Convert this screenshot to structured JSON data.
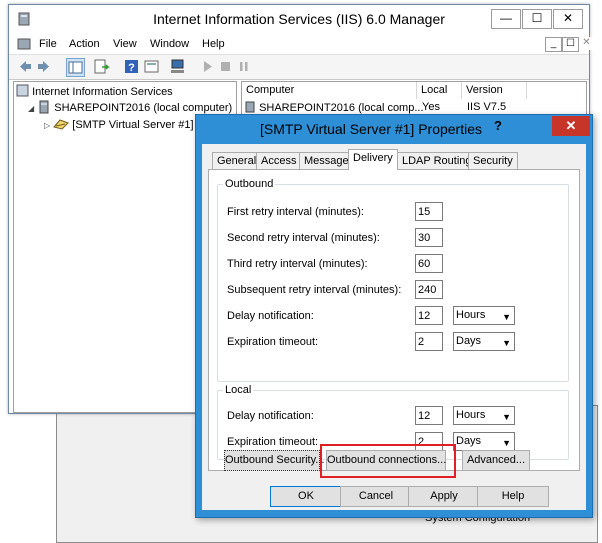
{
  "background_window": {
    "item_label": "System Configuration"
  },
  "iis": {
    "title": "Internet Information Services (IIS) 6.0 Manager",
    "caption": {
      "minimize": "—",
      "maximize": "☐",
      "close": "✕"
    },
    "menu": [
      "File",
      "Action",
      "View",
      "Window",
      "Help"
    ],
    "mdi": {
      "minimize": "_",
      "restore": "☐",
      "close": "✕"
    },
    "tree": {
      "root": "Internet Information Services",
      "computer": "SHAREPOINT2016 (local computer)",
      "server": "[SMTP Virtual Server #1]"
    },
    "list": {
      "columns": [
        "Computer",
        "Local",
        "Version"
      ],
      "rows": [
        {
          "computer": "SHAREPOINT2016 (local comp...",
          "local": "Yes",
          "version": "IIS V7.5"
        }
      ]
    }
  },
  "dialog": {
    "title": "[SMTP Virtual Server #1] Properties",
    "help_caption": "?",
    "close_caption": "✕",
    "tabs": [
      "General",
      "Access",
      "Messages",
      "Delivery",
      "LDAP Routing",
      "Security"
    ],
    "selected_tab": "Delivery",
    "outbound": {
      "label": "Outbound",
      "first_retry_label": "First retry interval (minutes):",
      "first_retry_value": "15",
      "second_retry_label": "Second retry interval (minutes):",
      "second_retry_value": "30",
      "third_retry_label": "Third retry interval (minutes):",
      "third_retry_value": "60",
      "subsequent_retry_label": "Subsequent retry interval (minutes):",
      "subsequent_retry_value": "240",
      "delay_label": "Delay notification:",
      "delay_value": "12",
      "delay_unit": "Hours",
      "expiration_label": "Expiration timeout:",
      "expiration_value": "2",
      "expiration_unit": "Days"
    },
    "local": {
      "label": "Local",
      "delay_label": "Delay notification:",
      "delay_value": "12",
      "delay_unit": "Hours",
      "expiration_label": "Expiration timeout:",
      "expiration_value": "2",
      "expiration_unit": "Days"
    },
    "buttons": {
      "outbound_security": "Outbound Security...",
      "outbound_connections": "Outbound connections...",
      "advanced": "Advanced...",
      "ok": "OK",
      "cancel": "Cancel",
      "apply": "Apply",
      "help": "Help"
    },
    "highlight_color": "#e01e26"
  }
}
